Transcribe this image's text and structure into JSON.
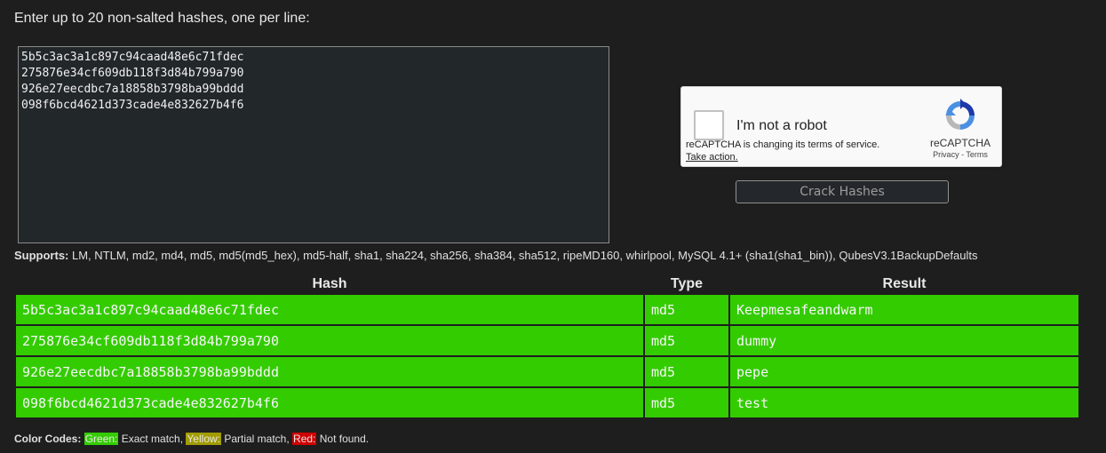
{
  "prompt": "Enter up to 20 non-salted hashes, one per line:",
  "input": {
    "value": "5b5c3ac3a1c897c94caad48e6c71fdec\n275876e34cf609db118f3d84b799a790\n926e27eecdbc7a18858b3798ba99bddd\n098f6bcd4621d373cade4e832627b4f6"
  },
  "recaptcha": {
    "label": "I'm not a robot",
    "notice": "reCAPTCHA is changing its terms of service.",
    "action": "Take action.",
    "brand": "reCAPTCHA",
    "privacy": "Privacy",
    "separator": " - ",
    "terms": "Terms",
    "logo_icon": "recaptcha-logo-icon"
  },
  "crack_button": "Crack Hashes",
  "supports": {
    "label": "Supports:",
    "text": " LM, NTLM, md2, md4, md5, md5(md5_hex), md5-half, sha1, sha224, sha256, sha384, sha512, ripeMD160, whirlpool, MySQL 4.1+ (sha1(sha1_bin)), QubesV3.1BackupDefaults"
  },
  "table": {
    "headers": [
      "Hash",
      "Type",
      "Result"
    ],
    "rows": [
      {
        "hash": "5b5c3ac3a1c897c94caad48e6c71fdec",
        "type": "md5",
        "result": "Keepmesafeandwarm",
        "status": "green"
      },
      {
        "hash": "275876e34cf609db118f3d84b799a790",
        "type": "md5",
        "result": "dummy",
        "status": "green"
      },
      {
        "hash": "926e27eecdbc7a18858b3798ba99bddd",
        "type": "md5",
        "result": "pepe",
        "status": "green"
      },
      {
        "hash": "098f6bcd4621d373cade4e832627b4f6",
        "type": "md5",
        "result": "test",
        "status": "green"
      }
    ]
  },
  "color_codes": {
    "label": "Color Codes:",
    "green": "Green:",
    "green_desc": " Exact match, ",
    "yellow": "Yellow:",
    "yellow_desc": " Partial match, ",
    "red": "Red:",
    "red_desc": " Not found."
  },
  "colors": {
    "background": "#1e1e1e",
    "green": "#33cc00",
    "yellow": "#a19c00",
    "red": "#d10000"
  }
}
